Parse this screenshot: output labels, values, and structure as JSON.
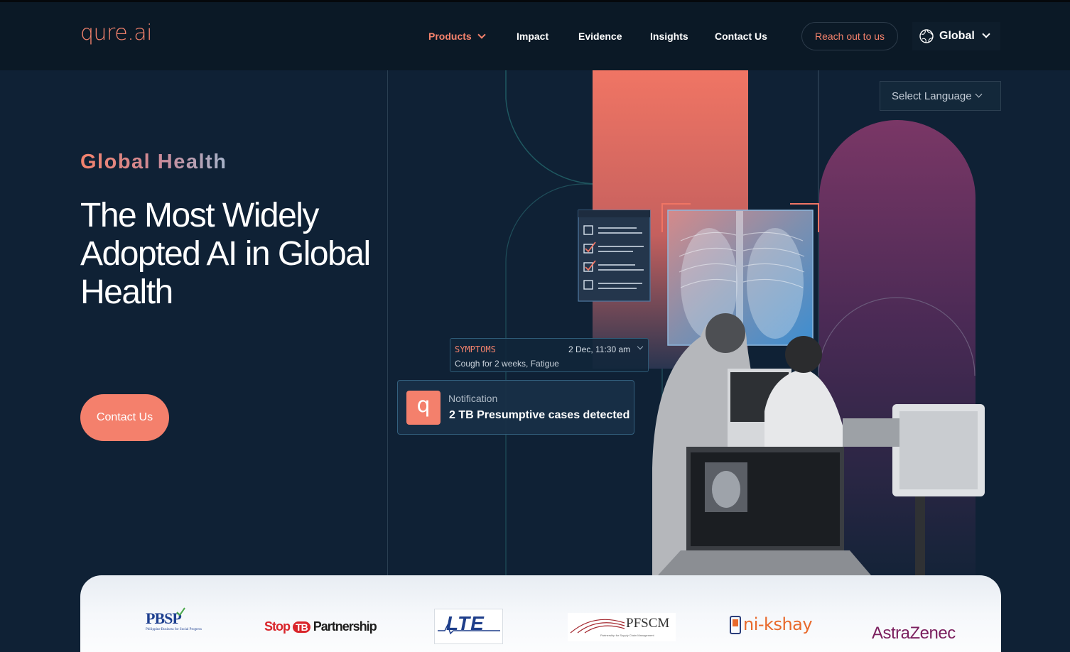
{
  "brand": {
    "logo_text": "qure.ai",
    "accent": "#f4806c",
    "navy": "#0f2135"
  },
  "nav": {
    "items": [
      {
        "label": "Products",
        "active": true,
        "has_dropdown": true
      },
      {
        "label": "Impact"
      },
      {
        "label": "Evidence"
      },
      {
        "label": "Insights"
      },
      {
        "label": "Contact Us"
      }
    ],
    "reach_out_label": "Reach out to us",
    "region_label": "Global",
    "region_icon": "globe-icon"
  },
  "language_select": {
    "label": "Select Language"
  },
  "hero": {
    "eyebrow": "Global Health",
    "headline": "The Most Widely Adopted AI in Global Health",
    "cta_label": "Contact Us"
  },
  "symptoms_card": {
    "label": "SYMPTOMS",
    "time": "2 Dec, 11:30 am",
    "text": "Cough for 2 weeks, Fatigue"
  },
  "notification": {
    "icon": "q",
    "title": "Notification",
    "message": "2 TB Presumptive cases detected"
  },
  "partners": [
    {
      "name": "PBSP",
      "subtitle": "Philippine Business for Social Progress"
    },
    {
      "name": "Stop TB Partnership",
      "part1": "Stop",
      "part2": "TB",
      "part3": "Partnership"
    },
    {
      "name": "LTE"
    },
    {
      "name": "PFSCM",
      "subtitle": "Partnership for Supply Chain Management"
    },
    {
      "name": "ni-kshay"
    },
    {
      "name": "AstraZeneca"
    }
  ]
}
